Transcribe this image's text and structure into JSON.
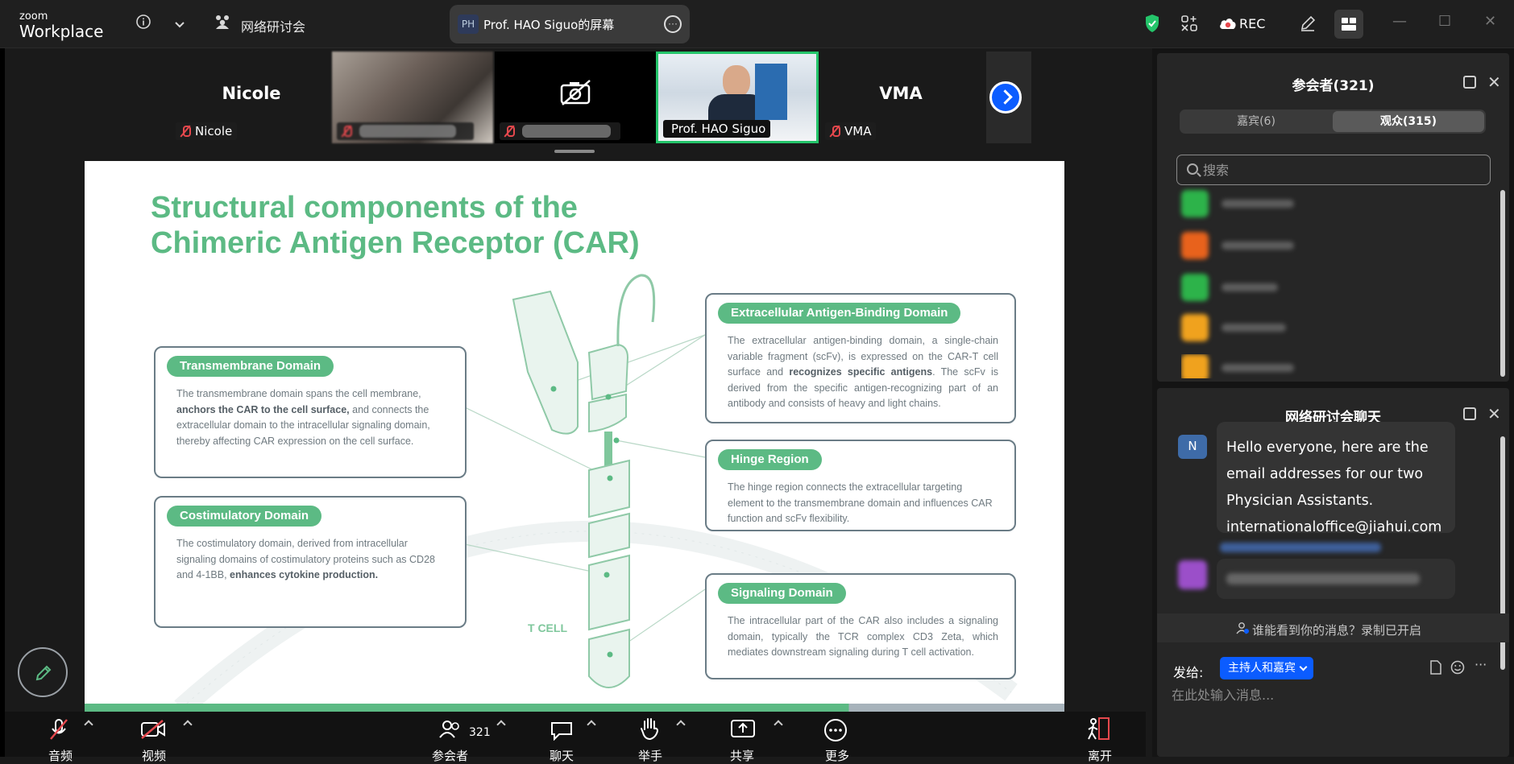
{
  "app": {
    "logo_line1": "zoom",
    "logo_line2": "Workplace"
  },
  "topbar": {
    "webinar_label": "网络研讨会",
    "share_initials": "PH",
    "share_title": "Prof. HAO Siguo的屏幕",
    "rec_label": "REC"
  },
  "video_strip": {
    "tiles": [
      {
        "display": "Nicole",
        "name": "Nicole",
        "muted": true
      },
      {
        "display": "",
        "name": "",
        "muted": true,
        "blurred": true
      },
      {
        "display": "",
        "name": "",
        "muted": true,
        "camera_off": true
      },
      {
        "display": "",
        "name": "Prof. HAO Siguo",
        "active_speaker": true
      },
      {
        "display": "VMA",
        "name": "VMA",
        "muted": true
      }
    ]
  },
  "slide": {
    "title_line1": "Structural components of the",
    "title_line2": "Chimeric Antigen Receptor (CAR)",
    "tcell_label": "T CELL",
    "boxes": {
      "transmembrane": {
        "label": "Transmembrane Domain",
        "text_a": "The transmembrane domain spans the cell membrane,",
        "text_b": "anchors the CAR to the cell surface,",
        "text_c": " and connects the extracellular domain to the intracellular signaling domain, thereby affecting CAR expression on the cell surface."
      },
      "costimulatory": {
        "label": "Costimulatory Domain",
        "text_a": "The costimulatory domain, derived from intracellular signaling domains of costimulatory proteins such as CD28 and 4-1BB, ",
        "text_b": "enhances cytokine production."
      },
      "extracellular": {
        "label": "Extracellular Antigen-Binding Domain",
        "text_a": "The extracellular antigen-binding domain, a single-chain variable fragment (scFv), is expressed on the CAR-T cell surface and ",
        "text_b": "recognizes specific antigens",
        "text_c": ". The scFv is derived from the specific antigen-recognizing part of an antibody and consists of heavy and light chains."
      },
      "hinge": {
        "label": "Hinge Region",
        "text": "The hinge region connects the extracellular targeting element to the transmembrane domain and influences CAR function and scFv flexibility."
      },
      "signaling": {
        "label": "Signaling Domain",
        "text": "The intracellular part of the CAR also includes a signaling domain, typically the TCR complex CD3 Zeta, which mediates downstream signaling during T cell activation."
      }
    }
  },
  "toolbar": {
    "audio": "音频",
    "video": "视频",
    "participants": "参会者",
    "participants_count": "321",
    "chat": "聊天",
    "raise_hand": "举手",
    "share": "共享",
    "more": "更多",
    "leave": "离开"
  },
  "participants_panel": {
    "title": "参会者(321)",
    "tab_panelists": "嘉宾(6)",
    "tab_attendees": "观众(315)",
    "search_placeholder": "搜索",
    "avatar_colors": [
      "#2db34a",
      "#e8621c",
      "#2db34a",
      "#f0a21e",
      "#f0a21e"
    ]
  },
  "chat_panel": {
    "title": "网络研讨会聊天",
    "sender_initial": "N",
    "message": "Hello everyone, here are the email addresses for our two Physician Assistants. internationaloffice@jiahui.com",
    "visibility_notice": "谁能看到你的消息？录制已开启",
    "send_to_label": "发给:",
    "recipient": "主持人和嘉宾",
    "input_placeholder": "在此处输入消息..."
  },
  "colors": {
    "accent_green": "#5cba84",
    "zoom_blue": "#0b5cff",
    "muted_red": "#e5484d",
    "speaker_border": "#24c46a"
  }
}
